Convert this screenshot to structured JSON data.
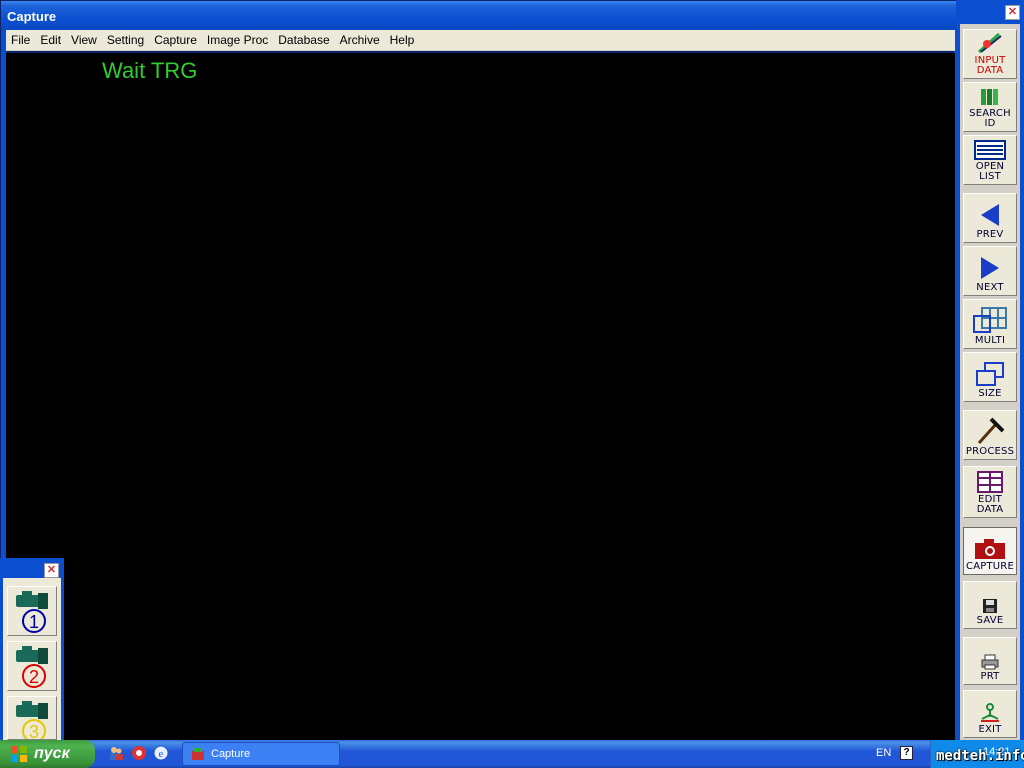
{
  "window": {
    "title": "Capture"
  },
  "menu": [
    "File",
    "Edit",
    "View",
    "Setting",
    "Capture",
    "Image Proc",
    "Database",
    "Archive",
    "Help"
  ],
  "viewport": {
    "status_text": "Wait TRG"
  },
  "toolbar": [
    {
      "label": "INPUT DATA",
      "icon": "pen-icon",
      "color": "#cc0000"
    },
    {
      "label": "SEARCH ID",
      "icon": "books-icon",
      "color": "#000066"
    },
    {
      "label": "OPEN LIST",
      "icon": "list-icon",
      "color": "#000066"
    },
    {
      "label": "PREV",
      "icon": "arrow-left-icon",
      "color": "#000066"
    },
    {
      "label": "NEXT",
      "icon": "arrow-right-icon",
      "color": "#000066"
    },
    {
      "label": "MULTI",
      "icon": "grid-icon",
      "color": "#000066"
    },
    {
      "label": "SIZE",
      "icon": "windows-icon",
      "color": "#000066"
    },
    {
      "label": "PROCESS",
      "icon": "hammer-icon",
      "color": "#000066"
    },
    {
      "label": "EDIT DATA",
      "icon": "edit-table-icon",
      "color": "#000066"
    },
    {
      "label": "CAPTURE",
      "icon": "camera-icon",
      "color": "#000066"
    },
    {
      "label": "SAVE",
      "icon": "floppy-icon",
      "color": "#000066"
    },
    {
      "label": "PRT",
      "icon": "printer-icon",
      "color": "#000066"
    },
    {
      "label": "EXIT",
      "icon": "exit-icon",
      "color": "#000066"
    }
  ],
  "cameras": [
    {
      "number": "1",
      "color": "#0000aa"
    },
    {
      "number": "2",
      "color": "#dd0000"
    },
    {
      "number": "3",
      "color": "#e6c800"
    }
  ],
  "taskbar": {
    "start_label": "пуск",
    "task_label": "Capture",
    "language": "EN",
    "help": "?",
    "clock": "14:21",
    "watermark": "medteh.info"
  }
}
